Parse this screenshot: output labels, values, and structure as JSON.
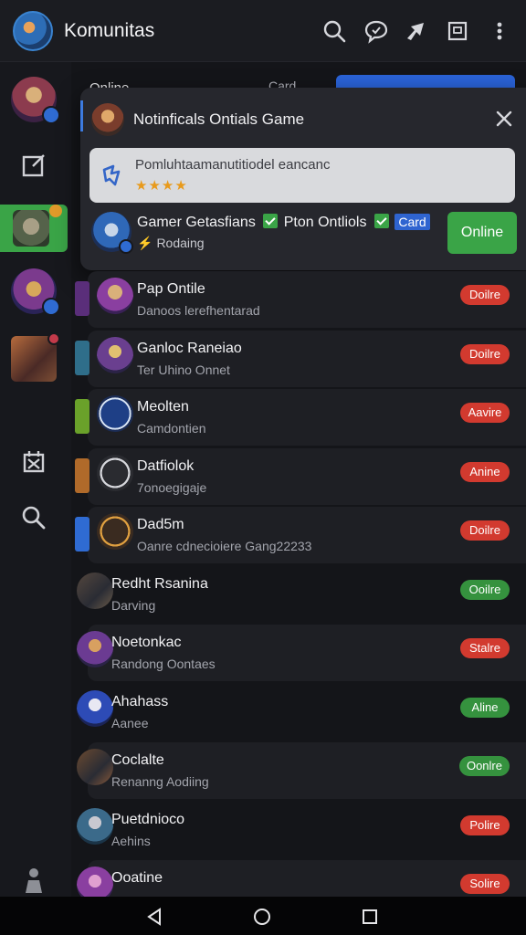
{
  "app": {
    "title": "Komunitas"
  },
  "topbar": {
    "icons": [
      "search-icon",
      "chat-bubble-icon",
      "share-icon",
      "window-icon",
      "more-vert-icon"
    ]
  },
  "rail": {
    "icons": [
      "edit-icon",
      "task-icon",
      "search-icon",
      "person-icon"
    ]
  },
  "background_tabs": {
    "online": "Online",
    "card": "Card"
  },
  "notification": {
    "title": "Notinficals Ontials Game",
    "card_text": "Pomluhtaamanutitiodel eancanc",
    "stars": "★★★★",
    "user_name": "Gamer Getasfians",
    "tag_text": "Pton Ontliols",
    "tag_card": "Card",
    "user_sub": "Rodaing",
    "online_button": "Online"
  },
  "list": {
    "items": [
      {
        "name": "Pap Ontile",
        "sub": "Danoos lerefhentarad",
        "status": "Doilre",
        "status_color": "#d23a2f"
      },
      {
        "name": "Ganloc Raneiao",
        "sub": "Ter Uhino Onnet",
        "status": "Doilre",
        "status_color": "#d23a2f"
      },
      {
        "name": "Meolten",
        "sub": "Camdontien",
        "status": "Aavire",
        "status_color": "#d23a2f"
      },
      {
        "name": "Datfiolok",
        "sub": "7onoegigaje",
        "status": "Anine",
        "status_color": "#d23a2f"
      },
      {
        "name": "Dad5m",
        "sub": "Oanre cdnecioiere Gang22233",
        "status": "Doilre",
        "status_color": "#d23a2f"
      },
      {
        "name": "Redht Rsanina",
        "sub": "Darving",
        "status": "Ooilre",
        "status_color": "#35923e"
      },
      {
        "name": "Noetonkac",
        "sub": "Randong Oontaes",
        "status": "Stalre",
        "status_color": "#d23a2f"
      },
      {
        "name": "Ahahass",
        "sub": "Aanee",
        "status": "Aline",
        "status_color": "#35923e"
      },
      {
        "name": "Coclalte",
        "sub": "Renanng Aodiing",
        "status": "Oonlre",
        "status_color": "#35923e"
      },
      {
        "name": "Puetdnioco",
        "sub": "Aehins",
        "status": "Polire",
        "status_color": "#d23a2f"
      },
      {
        "name": "Ooatine",
        "sub": "",
        "status": "Solire",
        "status_color": "#d23a2f"
      }
    ]
  },
  "system_nav": {
    "icons": [
      "back-icon",
      "home-icon",
      "recents-icon"
    ]
  }
}
